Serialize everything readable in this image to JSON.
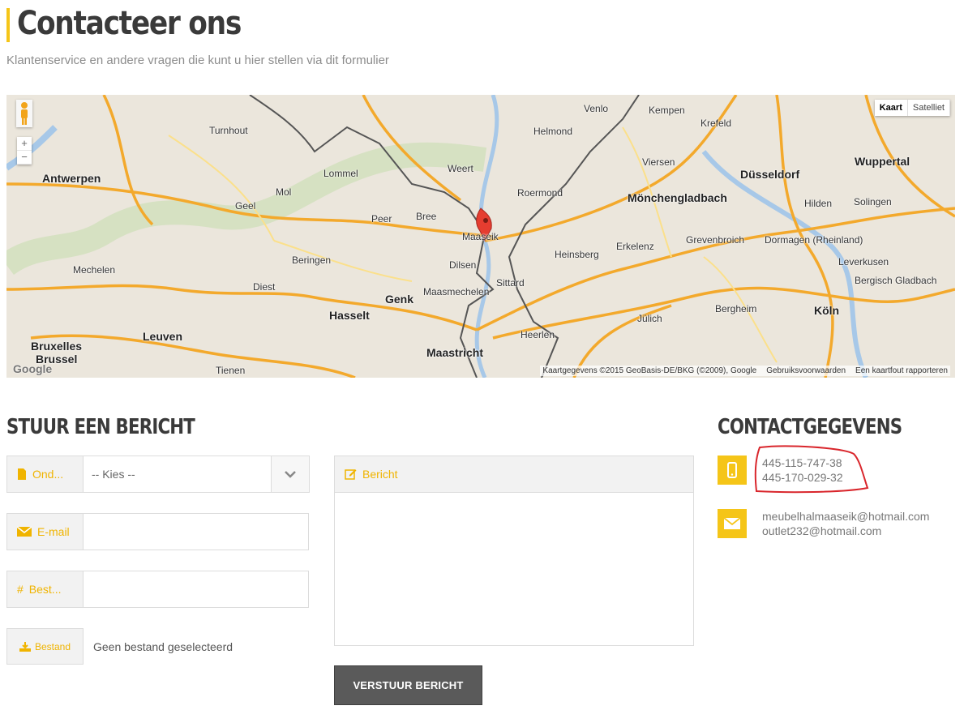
{
  "header": {
    "title": "Contacteer ons",
    "subtitle": "Klantenservice en andere vragen die kunt u hier stellen via dit formulier"
  },
  "map": {
    "type_buttons": [
      "Kaart",
      "Satelliet"
    ],
    "zoom_in": "+",
    "zoom_out": "−",
    "logo": "Google",
    "footer": [
      "Kaartgegevens ©2015 GeoBasis-DE/BKG (©2009), Google",
      "Gebruiksvoorwaarden",
      "Een kaartfout rapporteren"
    ],
    "labels": {
      "antwerpen": "Antwerpen",
      "bruxelles": "Bruxelles",
      "brussel": "Brussel",
      "leuven": "Leuven",
      "hasselt": "Hasselt",
      "genk": "Genk",
      "maastricht": "Maastricht",
      "maaseik": "Maaseik",
      "sittard": "Sittard",
      "heerlen": "Heerlen",
      "roermond": "Roermond",
      "venlo": "Venlo",
      "weert": "Weert",
      "moenchengladbach": "Mönchengladbach",
      "duesseldorf": "Düsseldorf",
      "koeln": "Köln",
      "wuppertal": "Wuppertal",
      "krefeld": "Krefeld",
      "solingen": "Solingen",
      "leverkusen": "Leverkusen",
      "turnhout": "Turnhout",
      "mol": "Mol",
      "geel": "Geel",
      "lommel": "Lommel",
      "beringen": "Beringen",
      "diest": "Diest",
      "tienen": "Tienen",
      "mechelen": "Mechelen",
      "bree": "Bree",
      "peer": "Peer",
      "dilsen": "Dilsen",
      "maasmechelen": "Maasmechelen",
      "heinsberg": "Heinsberg",
      "erkelenz": "Erkelenz",
      "viersen": "Viersen",
      "grevenbroich": "Grevenbroich",
      "dormagen": "Dormagen (Rheinland)",
      "bergheim": "Bergheim",
      "juelich": "Jülich",
      "eindhoven": "Helmond",
      "kempen": "Kempen",
      "neuss": "Hilden",
      "bergisch": "Bergisch Gladbach"
    }
  },
  "form": {
    "heading": "STUUR EEN BERICHT",
    "subject_label": "Ond...",
    "subject_value": "-- Kies --",
    "email_label": "E-mail",
    "order_label": "Best...",
    "file_button": "Bestand",
    "file_status": "Geen bestand geselecteerd",
    "message_label": "Bericht",
    "submit": "VERSTUUR BERICHT"
  },
  "contact": {
    "heading": "CONTACTGEGEVENS",
    "phone_1": "445-115-747-38",
    "phone_2": "445-170-029-32",
    "email_1": "meubelhalmaaseik@hotmail.com",
    "email_2": "outlet232@hotmail.com"
  },
  "colors": {
    "accent": "#f5c518",
    "button": "#5a5a5a",
    "annotation": "#d9262c"
  }
}
